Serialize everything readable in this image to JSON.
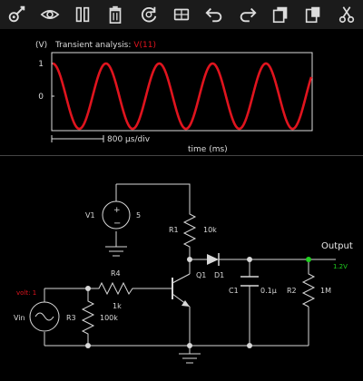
{
  "toolbar": [
    {
      "name": "settings-wrench-icon"
    },
    {
      "name": "view-eye-icon"
    },
    {
      "name": "pause-icon"
    },
    {
      "name": "trash-icon"
    },
    {
      "name": "reset-icon"
    },
    {
      "name": "rotate-view-icon"
    },
    {
      "name": "undo-icon"
    },
    {
      "name": "redo-icon"
    },
    {
      "name": "copy-icon"
    },
    {
      "name": "paste-icon"
    },
    {
      "name": "cut-scissors-icon"
    }
  ],
  "scope": {
    "unit": "(V)",
    "label": "Transient analysis:",
    "signal": "V(11)",
    "time_scale": "800 µs/div",
    "xlabel": "time (ms)",
    "colors": {
      "trace": "#e0141e",
      "signal_label": "#e0141e"
    }
  },
  "chart_data": {
    "type": "line",
    "title": "Transient analysis: V(11)",
    "xlabel": "time (ms)",
    "ylabel": "(V)",
    "yticks": [
      "1",
      "0"
    ],
    "ylim": [
      -1.2,
      1.2
    ],
    "grid": false,
    "series": [
      {
        "name": "V(11)",
        "shape": "sine",
        "amplitude": 1,
        "cycles": 4.85,
        "start_phase_deg": 90
      }
    ]
  },
  "circuit": {
    "v1": {
      "name": "V1",
      "value": "5"
    },
    "r1": {
      "name": "R1",
      "value": "10k"
    },
    "r4": {
      "name": "R4",
      "value": "1k"
    },
    "r3": {
      "name": "R3",
      "value": "100k"
    },
    "r2": {
      "name": "R2",
      "value": "1M"
    },
    "q1": {
      "name": "Q1"
    },
    "d1": {
      "name": "D1"
    },
    "c1": {
      "name": "C1",
      "value": "0.1µ"
    },
    "vin": {
      "name": "Vin",
      "probe": "volt: 1"
    },
    "output": {
      "label": "Output",
      "value": "1.2V"
    },
    "colors": {
      "probe": "#e0141e",
      "output_value": "#1fd11f"
    }
  }
}
